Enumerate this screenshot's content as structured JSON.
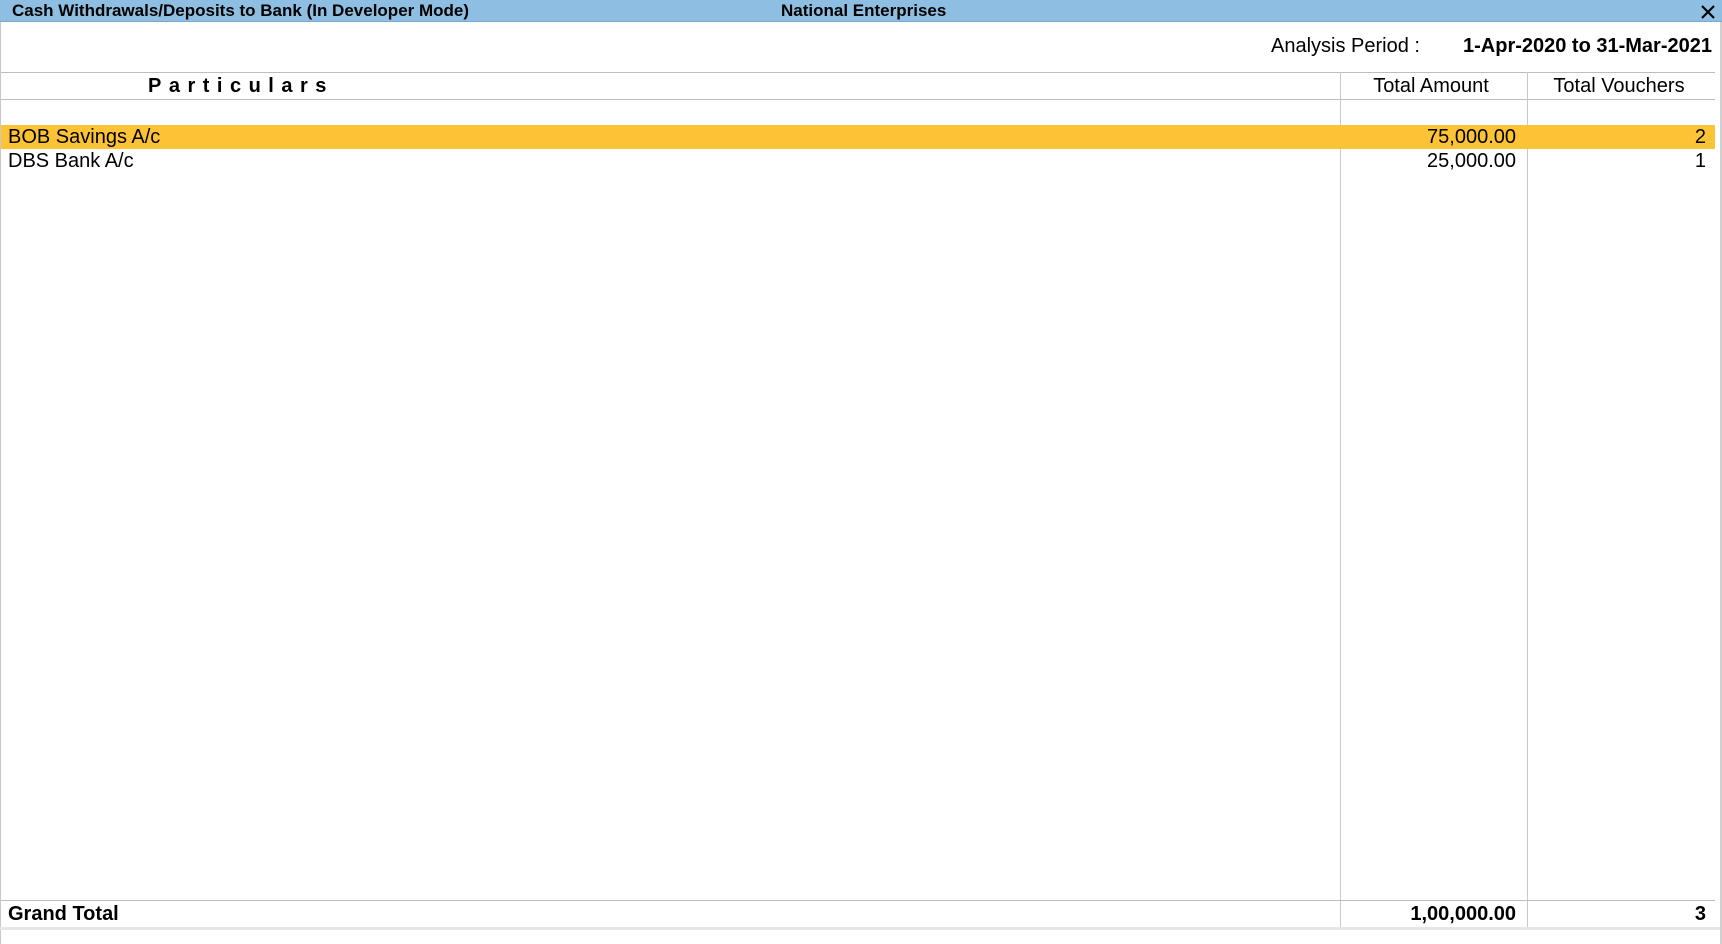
{
  "window": {
    "title": "Cash Withdrawals/Deposits to Bank (In Developer Mode)",
    "company": "National Enterprises",
    "close_icon": "close-icon"
  },
  "period": {
    "label": "Analysis Period :",
    "value": "1-Apr-2020 to 31-Mar-2021"
  },
  "table": {
    "headers": {
      "particulars": "Particulars",
      "amount": "Total Amount",
      "vouchers": "Total Vouchers"
    },
    "rows": [
      {
        "name": "BOB Savings A/c",
        "amount": "75,000.00",
        "vouchers": "2",
        "selected": true
      },
      {
        "name": "DBS Bank A/c",
        "amount": "25,000.00",
        "vouchers": "1",
        "selected": false
      }
    ],
    "total": {
      "label": "Grand Total",
      "amount": "1,00,000.00",
      "vouchers": "3"
    }
  },
  "colors": {
    "titlebar": "#8ebfe3",
    "selection": "#fdc336"
  }
}
